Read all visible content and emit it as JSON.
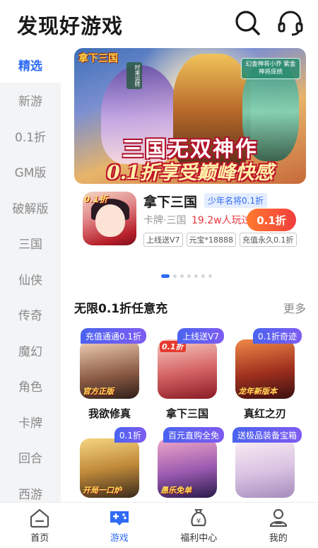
{
  "header": {
    "title": "发现好游戏",
    "search_icon": "search-icon",
    "support_icon": "headset-icon"
  },
  "sidebar": {
    "items": [
      {
        "label": "精选",
        "active": true
      },
      {
        "label": "新游"
      },
      {
        "label": "0.1折"
      },
      {
        "label": "GM版"
      },
      {
        "label": "破解版"
      },
      {
        "label": "三国"
      },
      {
        "label": "仙侠"
      },
      {
        "label": "传奇"
      },
      {
        "label": "魔幻"
      },
      {
        "label": "角色"
      },
      {
        "label": "卡牌"
      },
      {
        "label": "回合"
      },
      {
        "label": "西游"
      }
    ]
  },
  "banner": {
    "logo": "拿下三国",
    "tag_left": "时来运转",
    "tag_right": "幻金神将小乔 紫金神将庞统",
    "headline": "三国无双神作",
    "subline": "0.1折享受巅峰快感",
    "dots_total": 7,
    "dots_active": 0
  },
  "featured": {
    "badge": "0.1折",
    "name": "拿下三国",
    "tag": "少年名将0.1折",
    "meta": "卡牌·三国",
    "players": "19.2w人玩过",
    "cta": "0.1折",
    "chips": [
      "上线送V7",
      "元宝*18888",
      "充值永久0.1折"
    ]
  },
  "section": {
    "title": "无限0.1折任意充",
    "more": "更多"
  },
  "games": [
    {
      "name": "我欲修真",
      "badge": "充值通通0.1折",
      "img_tag": "官方正版",
      "colors": [
        "#e8b89c",
        "#6b4a3a"
      ]
    },
    {
      "name": "拿下三国",
      "badge": "上线送V7",
      "img_tag": "",
      "colors": [
        "#f0b8b0",
        "#b8202a"
      ]
    },
    {
      "name": "真红之刃",
      "badge": "0.1折奇迹",
      "img_tag": "龙年新版本",
      "colors": [
        "#e06a3a",
        "#4a1a1a"
      ]
    },
    {
      "name": "",
      "badge": "0.1折",
      "img_tag": "开局一口炉",
      "colors": [
        "#f0c56a",
        "#5a3a1a"
      ]
    },
    {
      "name": "",
      "badge": "百元直购全免",
      "img_tag": "愚乐免单",
      "colors": [
        "#e08ab0",
        "#3a2a5a"
      ]
    },
    {
      "name": "",
      "badge": "送极品装备宝箱",
      "img_tag": "",
      "colors": [
        "#f5e0ec",
        "#b89ac8"
      ]
    }
  ],
  "bottom_nav": [
    {
      "label": "首页",
      "icon": "home-icon"
    },
    {
      "label": "游戏",
      "icon": "gamepad-icon",
      "active": true
    },
    {
      "label": "福利中心",
      "icon": "moneybag-icon"
    },
    {
      "label": "我的",
      "icon": "user-icon"
    }
  ]
}
